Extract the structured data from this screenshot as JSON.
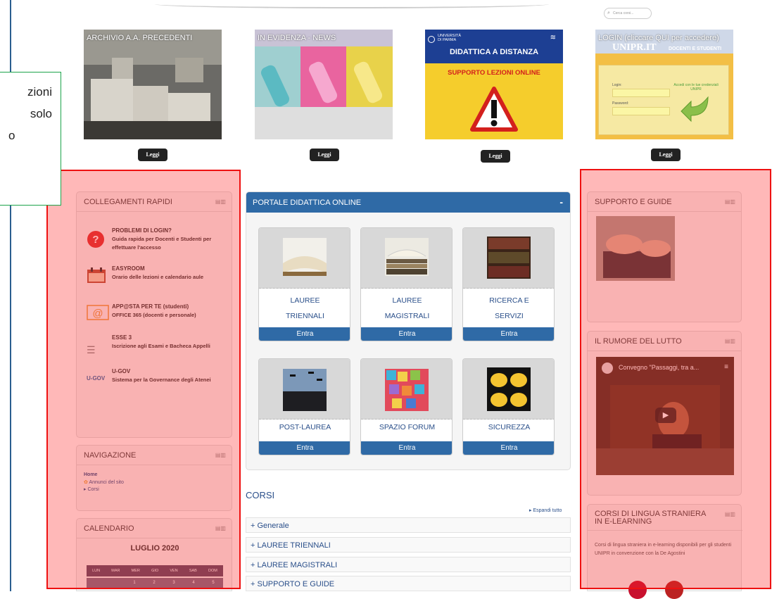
{
  "search": {
    "placeholder": "Cerca corsi..."
  },
  "notice": {
    "lines": [
      "zioni",
      "solo",
      "o"
    ]
  },
  "tiles": [
    {
      "caption": "ARCHIVIO A.A. PRECEDENTI",
      "button": "Leggi"
    },
    {
      "caption": "IN EVIDENZA - NEWS",
      "button": "Leggi"
    },
    {
      "caption": "",
      "button": "Leggi",
      "uni": "UNIVERSITÀ DI PARMA",
      "title": "DIDATTICA A DISTANZA",
      "subtitle": "SUPPORTO LEZIONI ONLINE"
    },
    {
      "caption": "LOGIN (cliccare QUI per accedere)",
      "button": "Leggi",
      "brand": "UNIPR.IT",
      "tag": "DOCENTI E STUDENTI",
      "note": "Accedi con le tue credenziali UNIPR",
      "login": "Login:",
      "password": "Password:"
    }
  ],
  "collegamenti": {
    "title": "COLLEGAMENTI RAPIDI",
    "items": [
      {
        "title": "PROBLEMI DI LOGIN?",
        "sub": "Guida rapida per Docenti e Studenti per effettuare l'accesso"
      },
      {
        "title": "EASYROOM",
        "sub": "Orario delle lezioni e calendario aule"
      },
      {
        "title": "APP@STA PER TE (studenti)",
        "sub": "OFFICE 365 (docenti e personale)"
      },
      {
        "title": "ESSE 3",
        "sub": "Iscrizione agli Esami e Bacheca Appelli"
      },
      {
        "title": "U-GOV",
        "sub": "Sistema per la Governance degli Atenei"
      }
    ],
    "ugov_logo": "U-GOV"
  },
  "navigazione": {
    "title": "NAVIGAZIONE",
    "home": "Home",
    "annunci": "Annunci del sito",
    "corsi": "Corsi"
  },
  "calendario": {
    "title": "CALENDARIO",
    "month": "LUGLIO 2020",
    "days": [
      "LUN",
      "MAR",
      "MER",
      "GIO",
      "VEN",
      "SAB",
      "DOM"
    ],
    "dates": [
      "1",
      "2",
      "3",
      "4",
      "5"
    ]
  },
  "portale": {
    "title": "PORTALE DIDATTICA ONLINE",
    "minimize": "-",
    "cards": [
      {
        "label1": "LAUREE",
        "label2": "TRIENNALI",
        "button": "Entra"
      },
      {
        "label1": "LAUREE",
        "label2": "MAGISTRALI",
        "button": "Entra"
      },
      {
        "label1": "RICERCA E",
        "label2": "SERVIZI",
        "button": "Entra"
      },
      {
        "label1": "POST-LAUREA",
        "label2": "",
        "button": "Entra"
      },
      {
        "label1": "SPAZIO FORUM",
        "label2": "",
        "button": "Entra"
      },
      {
        "label1": "SICUREZZA",
        "label2": "",
        "button": "Entra"
      }
    ]
  },
  "corsi": {
    "title": "CORSI",
    "expand": "Espandi tutto",
    "rows": [
      "Generale",
      "LAUREE TRIENNALI",
      "LAUREE MAGISTRALI",
      "SUPPORTO E GUIDE"
    ]
  },
  "supporto": {
    "title": "SUPPORTO E GUIDE"
  },
  "rumore": {
    "title": "IL RUMORE DEL LUTTO",
    "video_title": "Convegno \"Passaggi, tra a..."
  },
  "lingua": {
    "title1": "CORSI DI LINGUA STRANIERA",
    "title2": "IN E-LEARNING",
    "text": "Corsi di lingua straniera in e-learning disponibili per gli studenti UNIPR in convenzione con la De Agostini"
  },
  "colors": {
    "accent": "#2f6aa6",
    "overlay": "#e11111",
    "notice_border": "#1ca34a"
  }
}
